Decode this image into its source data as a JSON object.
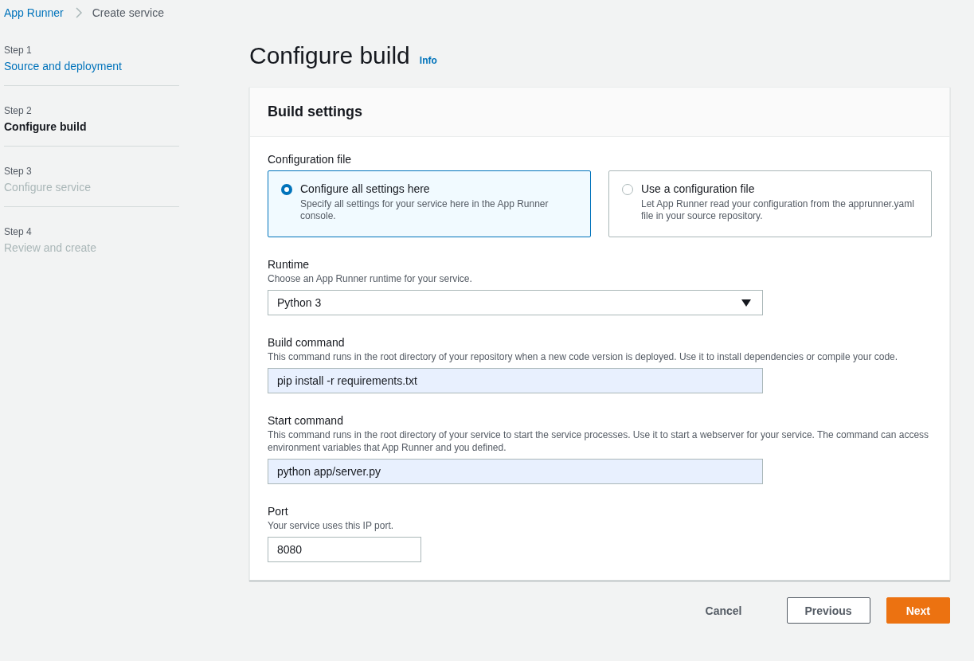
{
  "breadcrumbs": {
    "links": [
      "App Runner"
    ],
    "current": "Create service"
  },
  "steps": [
    {
      "step": "Step 1",
      "label": "Source and deployment",
      "selected": false,
      "disabled": false
    },
    {
      "step": "Step 2",
      "label": "Configure build",
      "selected": true,
      "disabled": false
    },
    {
      "step": "Step 3",
      "label": "Configure service",
      "selected": false,
      "disabled": true
    },
    {
      "step": "Step 4",
      "label": "Review and create",
      "selected": false,
      "disabled": true
    }
  ],
  "page": {
    "title": "Configure build",
    "info": "Info"
  },
  "panel": {
    "title": "Build settings",
    "config_file": {
      "label": "Configuration file",
      "options": [
        {
          "title": "Configure all settings here",
          "description": "Specify all settings for your service here in the App Runner console.",
          "selected": true
        },
        {
          "title": "Use a configuration file",
          "description": "Let App Runner read your configuration from the apprunner.yaml file in your source repository.",
          "selected": false
        }
      ]
    },
    "fields": [
      {
        "kind": "select",
        "label": "Runtime",
        "description": "Choose an App Runner runtime for your service.",
        "value": "Python 3"
      },
      {
        "kind": "text",
        "label": "Build command",
        "description": "This command runs in the root directory of your repository when a new code version is deployed. Use it to install dependencies or compile your code.",
        "value": "pip install -r requirements.txt"
      },
      {
        "kind": "text",
        "label": "Start command",
        "description": "This command runs in the root directory of your service to start the service processes. Use it to start a webserver for your service. The command can access environment variables that App Runner and you defined.",
        "value": "python app/server.py"
      },
      {
        "kind": "number",
        "label": "Port",
        "description": "Your service uses this IP port.",
        "value": "8080"
      }
    ]
  },
  "buttons": [
    {
      "label": "Cancel",
      "kind": "link"
    },
    {
      "label": "Previous",
      "kind": "normal"
    },
    {
      "label": "Next",
      "kind": "primary"
    }
  ]
}
